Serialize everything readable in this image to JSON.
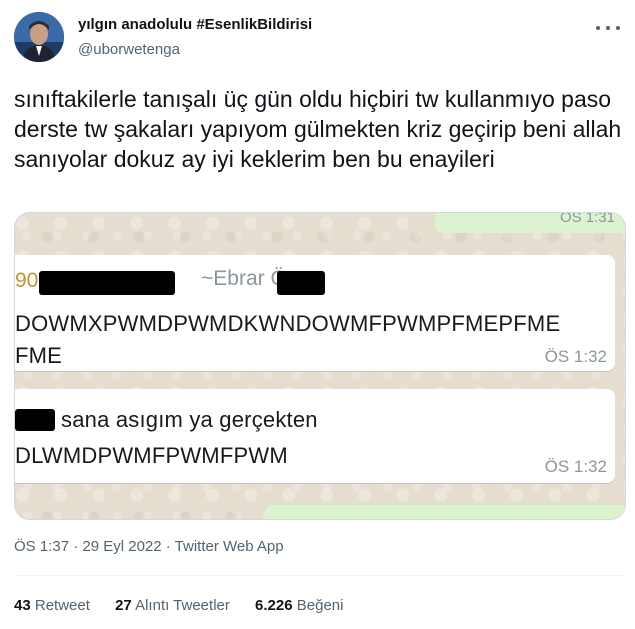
{
  "tweet": {
    "author_name": "yılgın anadolulu #EsenlikBildirisi",
    "author_handle": "@uborwetenga",
    "text": "sınıftakilerle tanışalı üç gün oldu hiçbiri tw kullanmıyo paso derste tw şakaları yapıyom gülmekten kriz geçirip beni allah sanıyolar dokuz ay iyi keklerim ben bu enayileri",
    "meta": "ÖS 1:37 · 29 Eyl 2022 · Twitter Web App"
  },
  "chat_image": {
    "top_timestamp": "ÖS 1:31",
    "message1": {
      "sender_number_fragment": "90",
      "sender_name": "~Ebrar Ö",
      "line1": "DOWMXPWMDPWMDKWNDOWMFPWMPFMEPFME",
      "line2": "FME",
      "timestamp": "ÖS 1:32"
    },
    "message2": {
      "line1": "sana asıgım ya gerçekten",
      "line2": "DLWMDPWMFPWMFPWM",
      "timestamp": "ÖS 1:32"
    }
  },
  "stats": {
    "retweets_count": "43",
    "retweets_label": "Retweet",
    "quotes_count": "27",
    "quotes_label": "Alıntı Tweetler",
    "likes_count": "6.226",
    "likes_label": "Beğeni"
  },
  "colors": {
    "text_primary": "#0f1419",
    "text_secondary": "#536471",
    "border": "#cfd9de",
    "chat_background": "#e6ddd1",
    "chat_outgoing_bubble": "#dcf3cf",
    "sender_number": "#c8923a"
  },
  "icons": {
    "more_options": "more-horizontal-icon"
  }
}
